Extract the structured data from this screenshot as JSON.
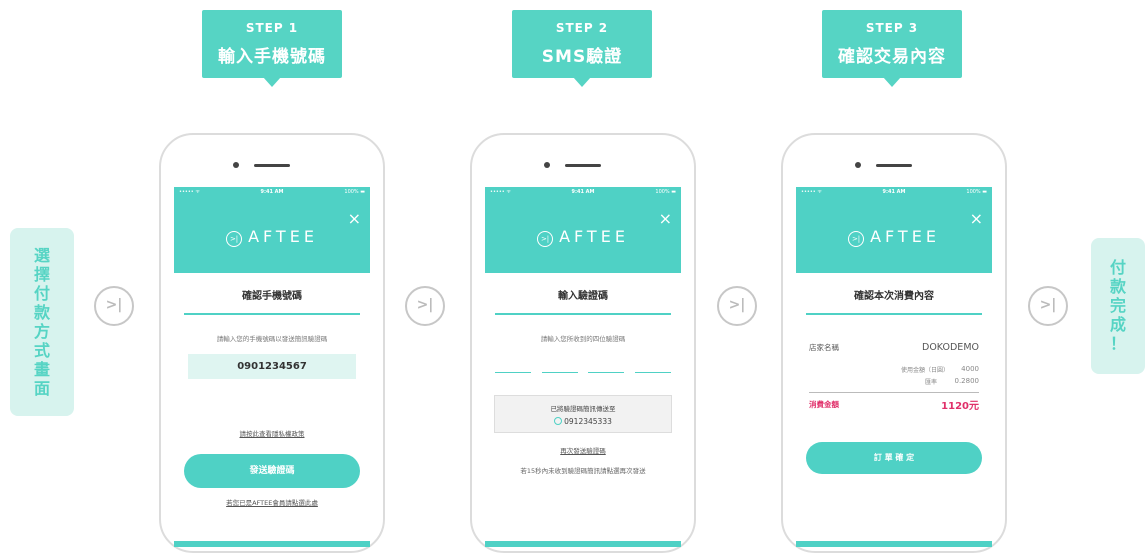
{
  "steps": [
    {
      "step": "STEP 1",
      "title": "輸入手機號碼"
    },
    {
      "step": "STEP 2",
      "title": "SMS驗證"
    },
    {
      "step": "STEP 3",
      "title": "確認交易內容"
    }
  ],
  "left_label": [
    "選",
    "擇",
    "付",
    "款",
    "方",
    "式",
    "畫",
    "面"
  ],
  "right_label": [
    "付",
    "款",
    "完",
    "成",
    "！"
  ],
  "arrow_symbol": ">|",
  "status_bar": {
    "carrier": "••••• ᯤ",
    "time": "9:41 AM",
    "battery": "100% ▬"
  },
  "app": {
    "logo": "AFTEE",
    "logo_mark": ">|",
    "close": "×",
    "color": "#4fd1c5"
  },
  "screen1": {
    "title": "確認手機號碼",
    "desc": "請輸入您的手機號碼以發送簡訊驗證碼",
    "phone": "0901234567",
    "privacy_link": "請按此查看隱私權政策",
    "send_button": "發送驗證碼",
    "member_link": "若您已是AFTEE會員請點選此處"
  },
  "screen2": {
    "title": "輸入驗證碼",
    "desc": "請輸入您所收到的四位驗證碼",
    "sent_text": "已將驗證碼簡訊傳送至",
    "sent_phone": "0912345333",
    "resend_link": "再次發送驗證碼",
    "note": "若15秒內未收到驗證碼簡訊請點選再次發送"
  },
  "screen3": {
    "title": "確認本次消費內容",
    "store_label": "店家名稱",
    "store_value": "DOKODEMO",
    "amount_label": "使用金額（日圓）",
    "amount_value": "4000",
    "rate_label": "匯率",
    "rate_value": "0.2800",
    "total_label": "消費金額",
    "total_value": "1120元",
    "confirm_button": "訂 單 確 定"
  }
}
